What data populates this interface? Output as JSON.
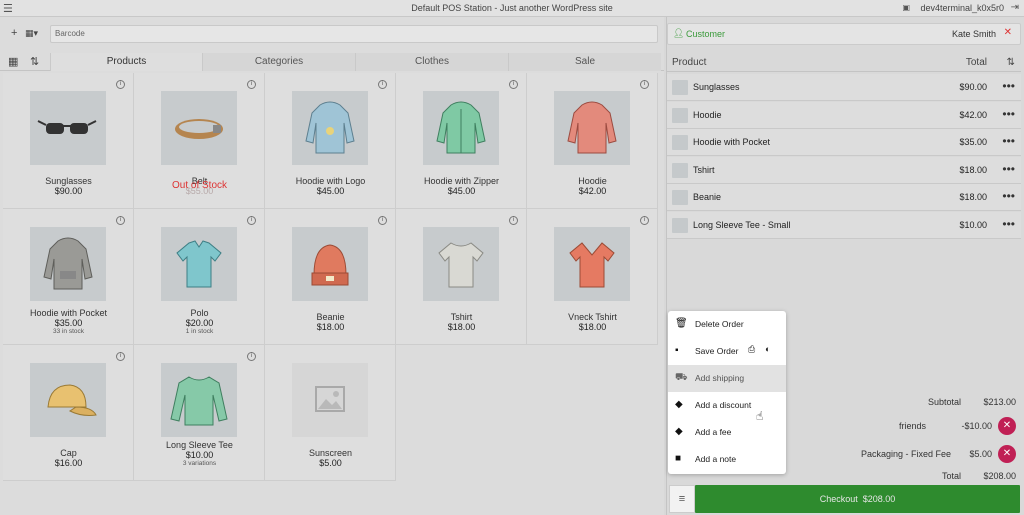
{
  "topbar": {
    "title": "Default POS Station - Just another WordPress site",
    "station": "dev4terminal_k0x5r0"
  },
  "left": {
    "barcode_placeholder": "Barcode",
    "tabs": [
      {
        "label": "Products",
        "active": true
      },
      {
        "label": "Categories",
        "active": false
      },
      {
        "label": "Clothes",
        "active": false
      },
      {
        "label": "Sale",
        "active": false
      }
    ],
    "products": [
      {
        "name": "Sunglasses",
        "price": "$90.00",
        "icon": "sunglasses"
      },
      {
        "name": "Belt",
        "price": "$55.00",
        "out_of_stock": "Out of Stock",
        "icon": "belt"
      },
      {
        "name": "Hoodie with Logo",
        "price": "$45.00",
        "icon": "hoodie"
      },
      {
        "name": "Hoodie with Zipper",
        "price": "$45.00",
        "icon": "hoodie"
      },
      {
        "name": "Hoodie",
        "price": "$42.00",
        "icon": "hoodie"
      },
      {
        "name": "Hoodie with Pocket",
        "price": "$35.00",
        "stock": "33 in stock",
        "icon": "hoodie"
      },
      {
        "name": "Polo",
        "price": "$20.00",
        "stock": "1 in stock",
        "icon": "polo"
      },
      {
        "name": "Beanie",
        "price": "$18.00",
        "icon": "beanie"
      },
      {
        "name": "Tshirt",
        "price": "$18.00",
        "icon": "tshirt"
      },
      {
        "name": "Vneck Tshirt",
        "price": "$18.00",
        "icon": "tshirt"
      },
      {
        "name": "Cap",
        "price": "$16.00",
        "icon": "cap"
      },
      {
        "name": "Long Sleeve Tee",
        "price": "$10.00",
        "stock": "3 variations",
        "icon": "long-sleeve"
      },
      {
        "name": "Sunscreen",
        "price": "$5.00",
        "icon": "image-placeholder"
      }
    ]
  },
  "cart": {
    "customer_label": "Customer",
    "customer_name": "Kate Smith",
    "header_product": "Product",
    "header_total": "Total",
    "lines": [
      {
        "name": "Sunglasses",
        "total": "$90.00"
      },
      {
        "name": "Hoodie",
        "total": "$42.00"
      },
      {
        "name": "Hoodie with Pocket",
        "total": "$35.00"
      },
      {
        "name": "Tshirt",
        "total": "$18.00"
      },
      {
        "name": "Beanie",
        "total": "$18.00"
      },
      {
        "name": "Long Sleeve Tee - Small",
        "total": "$10.00"
      }
    ],
    "subtotal_label": "Subtotal",
    "subtotal": "$213.00",
    "discount_label": "friends",
    "discount": "-$10.00",
    "fee_label": "Packaging - Fixed Fee",
    "fee": "$5.00",
    "total_label": "Total",
    "total": "$208.00",
    "checkout_label": "Checkout",
    "checkout_amount": "$208.00"
  },
  "menu": {
    "items": [
      {
        "label": "Delete Order",
        "icon": "trash-icon"
      },
      {
        "label": "Save Order",
        "icon": "save-icon"
      },
      {
        "label": "Add shipping",
        "icon": "truck-icon",
        "highlighted": true
      },
      {
        "label": "Add a discount",
        "icon": "tag-icon"
      },
      {
        "label": "Add a fee",
        "icon": "diamond-icon"
      },
      {
        "label": "Add a note",
        "icon": "note-icon"
      }
    ]
  },
  "colors": {
    "accent_green": "#2e8b2e",
    "remove_red": "#c02055",
    "out_of_stock": "#dd3333"
  }
}
